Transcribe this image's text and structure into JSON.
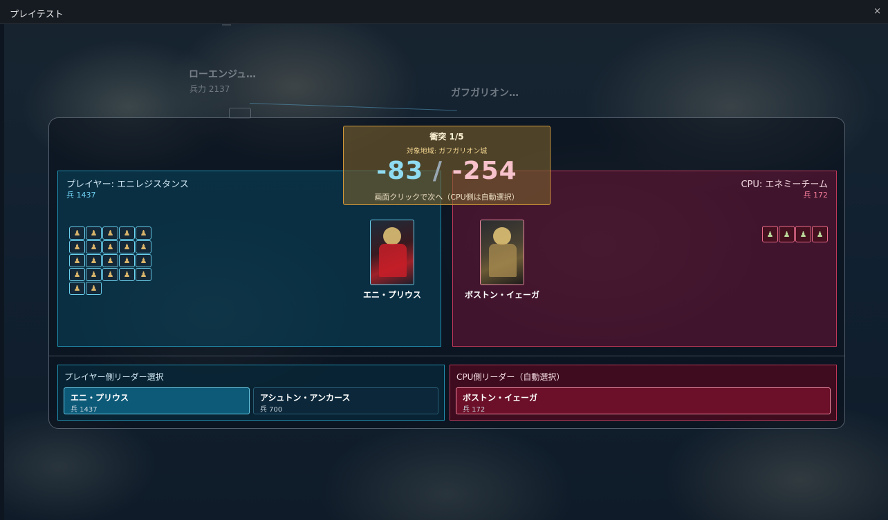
{
  "window": {
    "title": "プレイテスト",
    "close_glyph": "×"
  },
  "map": {
    "regions": [
      {
        "name": "ローエンジュ…",
        "troops": "兵力 2137"
      },
      {
        "name": "ガフガリオン…"
      }
    ]
  },
  "clash": {
    "title": "衝突 1/5",
    "target": "対象地域: ガフガリオン城",
    "damage_player": "-83",
    "separator": "/",
    "damage_cpu": "-254",
    "hint": "画面クリックで次へ（CPU側は自動選択）"
  },
  "player": {
    "name": "プレイヤー: エニレジスタンス",
    "troops": "兵 1437",
    "soldier_icon_count": 22,
    "card_name": "エニ・プリウス"
  },
  "cpu": {
    "name": "CPU: エネミーチーム",
    "troops": "兵 172",
    "soldier_icon_count": 4,
    "card_name": "ボストン・イェーガ"
  },
  "leader_select": {
    "player_title": "プレイヤー側リーダー選択",
    "cpu_title": "CPU側リーダー（自動選択）",
    "player_options": [
      {
        "name": "エニ・プリウス",
        "troops": "兵 1437",
        "selected": true
      },
      {
        "name": "アシュトン・アンカース",
        "troops": "兵 700",
        "selected": false
      }
    ],
    "cpu_options": [
      {
        "name": "ボストン・イェーガ",
        "troops": "兵 172",
        "selected": true
      }
    ]
  },
  "colors": {
    "player_accent": "#6ad0ee",
    "cpu_accent": "#f08aa2",
    "clash_border": "#d49a3a"
  },
  "icons": {
    "soldier": "soldier-icon",
    "close": "close-icon"
  }
}
